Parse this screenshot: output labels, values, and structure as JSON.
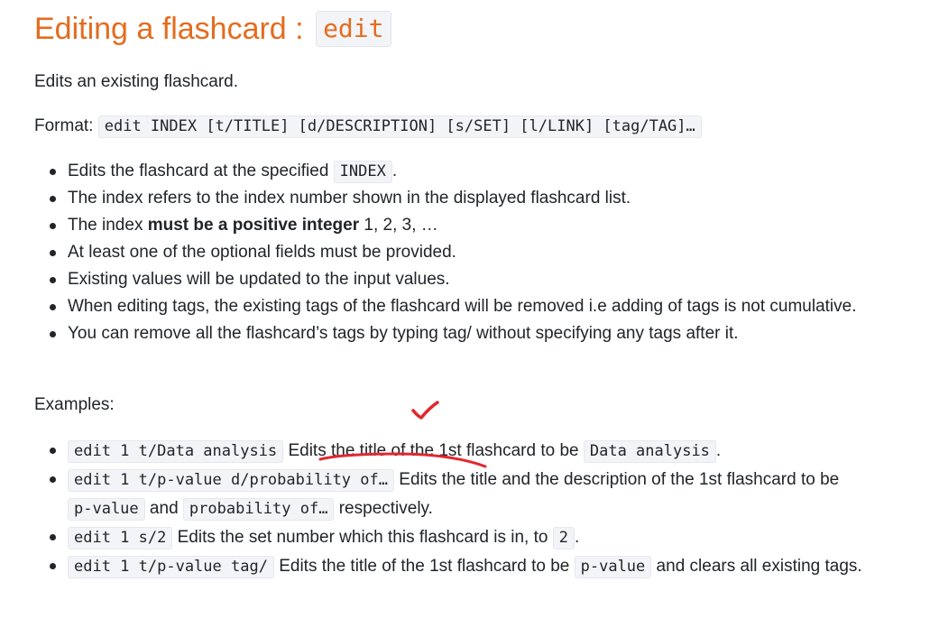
{
  "heading": {
    "text": "Editing a flashcard : ",
    "code": "edit"
  },
  "intro": "Edits an existing flashcard.",
  "format": {
    "label": "Format:",
    "code": "edit INDEX [t/TITLE] [d/DESCRIPTION] [s/SET] [l/LINK] [tag/TAG]…"
  },
  "rules": {
    "item1_text": "Edits the flashcard at the specified ",
    "item1_code": "INDEX",
    "item1_end": ".",
    "item2": "The index refers to the index number shown in the displayed flashcard list.",
    "item3_pre": "The index ",
    "item3_bold": "must be a positive integer",
    "item3_post": " 1, 2, 3, …",
    "item4": "At least one of the optional fields must be provided.",
    "item5": "Existing values will be updated to the input values.",
    "item6": "When editing tags, the existing tags of the flashcard will be removed i.e adding of tags is not cumulative.",
    "item7": "You can remove all the flashcard’s tags by typing tag/ without specifying any tags after it."
  },
  "examples": {
    "label": "Examples:",
    "ex1_code": "edit 1 t/Data analysis",
    "ex1_text": " Edits the title of the 1st flashcard to be ",
    "ex1_code2": "Data analysis",
    "ex1_end": ".",
    "ex2_code": "edit 1 t/p-value d/probability of…",
    "ex2_text": " Edits the title and the description of the 1st flashcard to be ",
    "ex2_code2": "p-value",
    "ex2_and": " and ",
    "ex2_code3": "probability of…",
    "ex2_end": " respectively.",
    "ex3_code": "edit 1 s/2",
    "ex3_text": " Edits the set number which this flashcard is in, to ",
    "ex3_code2": "2",
    "ex3_end": ".",
    "ex4_code": "edit 1 t/p-value tag/",
    "ex4_text": " Edits the title of the 1st flashcard to be ",
    "ex4_code2": "p-value",
    "ex4_end": " and clears all existing tags."
  },
  "annotations": {
    "color": "#e0282e",
    "checkmark": "checkmark-icon",
    "underline": "underline-mark"
  }
}
